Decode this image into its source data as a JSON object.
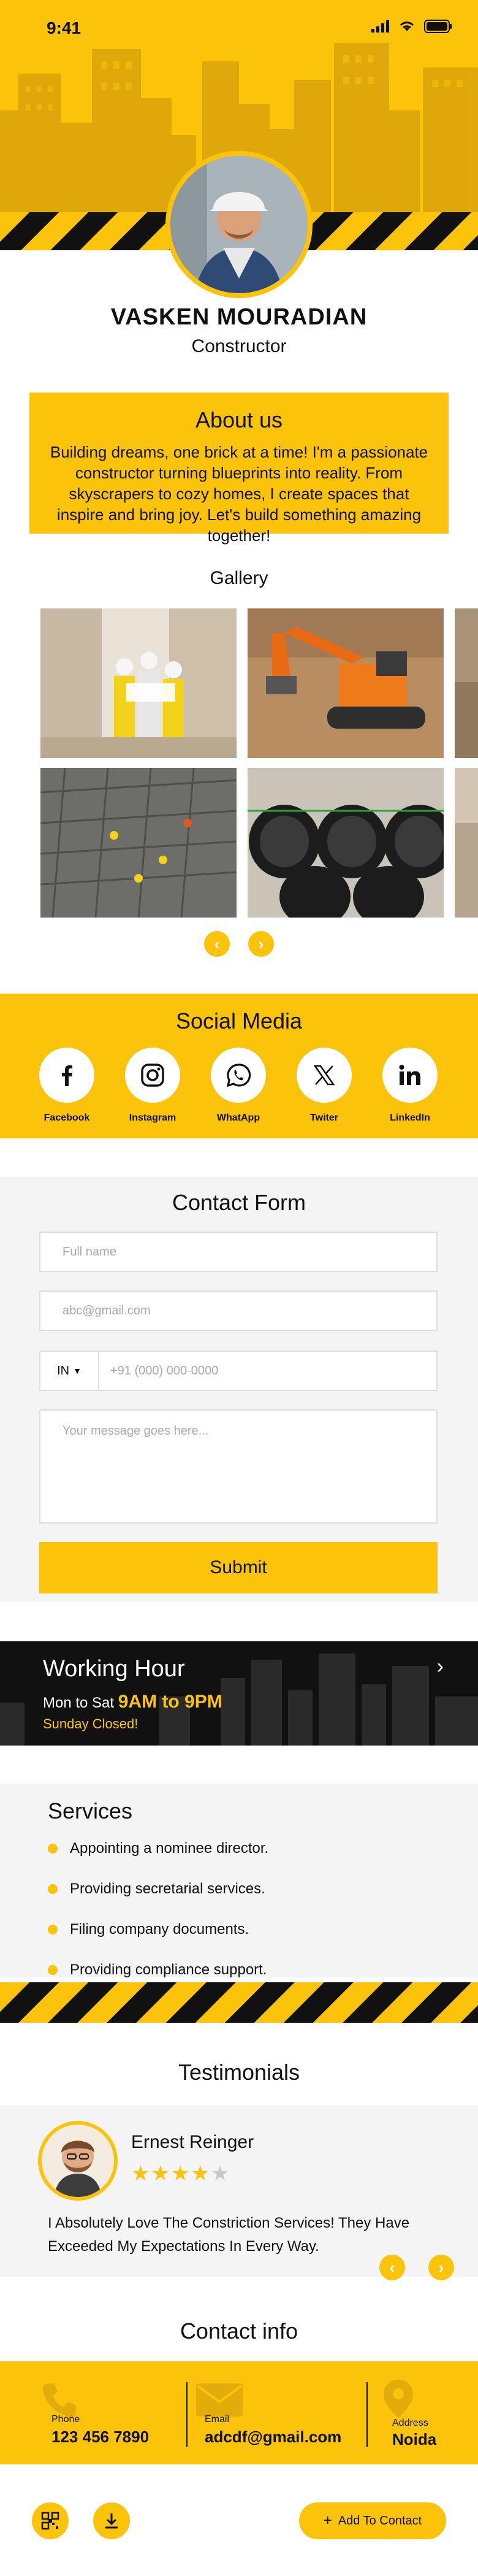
{
  "status_bar": {
    "time": "9:41"
  },
  "profile": {
    "name": "VASKEN MOURADIAN",
    "role": "Constructor"
  },
  "about": {
    "title": "About us",
    "text": "Building dreams, one brick at a time! I'm a passionate constructor turning blueprints into reality. From skyscrapers to cozy homes, I create spaces that inspire and bring joy. Let's build something amazing together!"
  },
  "gallery": {
    "title": "Gallery"
  },
  "social": {
    "title": "Social Media",
    "items": [
      {
        "label": "Facebook",
        "icon": "facebook-icon"
      },
      {
        "label": "Instagram",
        "icon": "instagram-icon"
      },
      {
        "label": "WhatApp",
        "icon": "whatsapp-icon"
      },
      {
        "label": "Twiter",
        "icon": "x-twitter-icon"
      },
      {
        "label": "LinkedIn",
        "icon": "linkedin-icon"
      }
    ]
  },
  "contact_form": {
    "title": "Contact Form",
    "name_placeholder": "Full name",
    "email_placeholder": "abc@gmail.com",
    "country_code": "IN",
    "phone_placeholder": "+91 (000) 000-0000",
    "message_placeholder": "Your message goes here...",
    "submit_label": "Submit"
  },
  "working_hours": {
    "title": "Working Hour",
    "days": "Mon to Sat",
    "hours": "9AM to 9PM",
    "closed": "Sunday Closed!"
  },
  "services": {
    "title": "Services",
    "items": [
      "Appointing a nominee director.",
      "Providing secretarial services.",
      "Filing company documents.",
      "Providing compliance support."
    ]
  },
  "testimonials": {
    "title": "Testimonials",
    "name": "Ernest Reinger",
    "rating": 4,
    "stars_filled": "★★★★",
    "stars_empty": "★",
    "text": "I Absolutely Love The Constriction Services! They Have Exceeded My Expectations In Every Way."
  },
  "contact_info": {
    "title": "Contact info",
    "phone_label": "Phone",
    "phone": "123 456 7890",
    "email_label": "Email",
    "email": "adcdf@gmail.com",
    "address_label": "Address",
    "address": "Noida"
  },
  "bottom_bar": {
    "add_contact_label": "Add To Contact"
  },
  "colors": {
    "accent": "#fcc30b",
    "dark": "#111111",
    "light_bg": "#f4f4f4"
  }
}
